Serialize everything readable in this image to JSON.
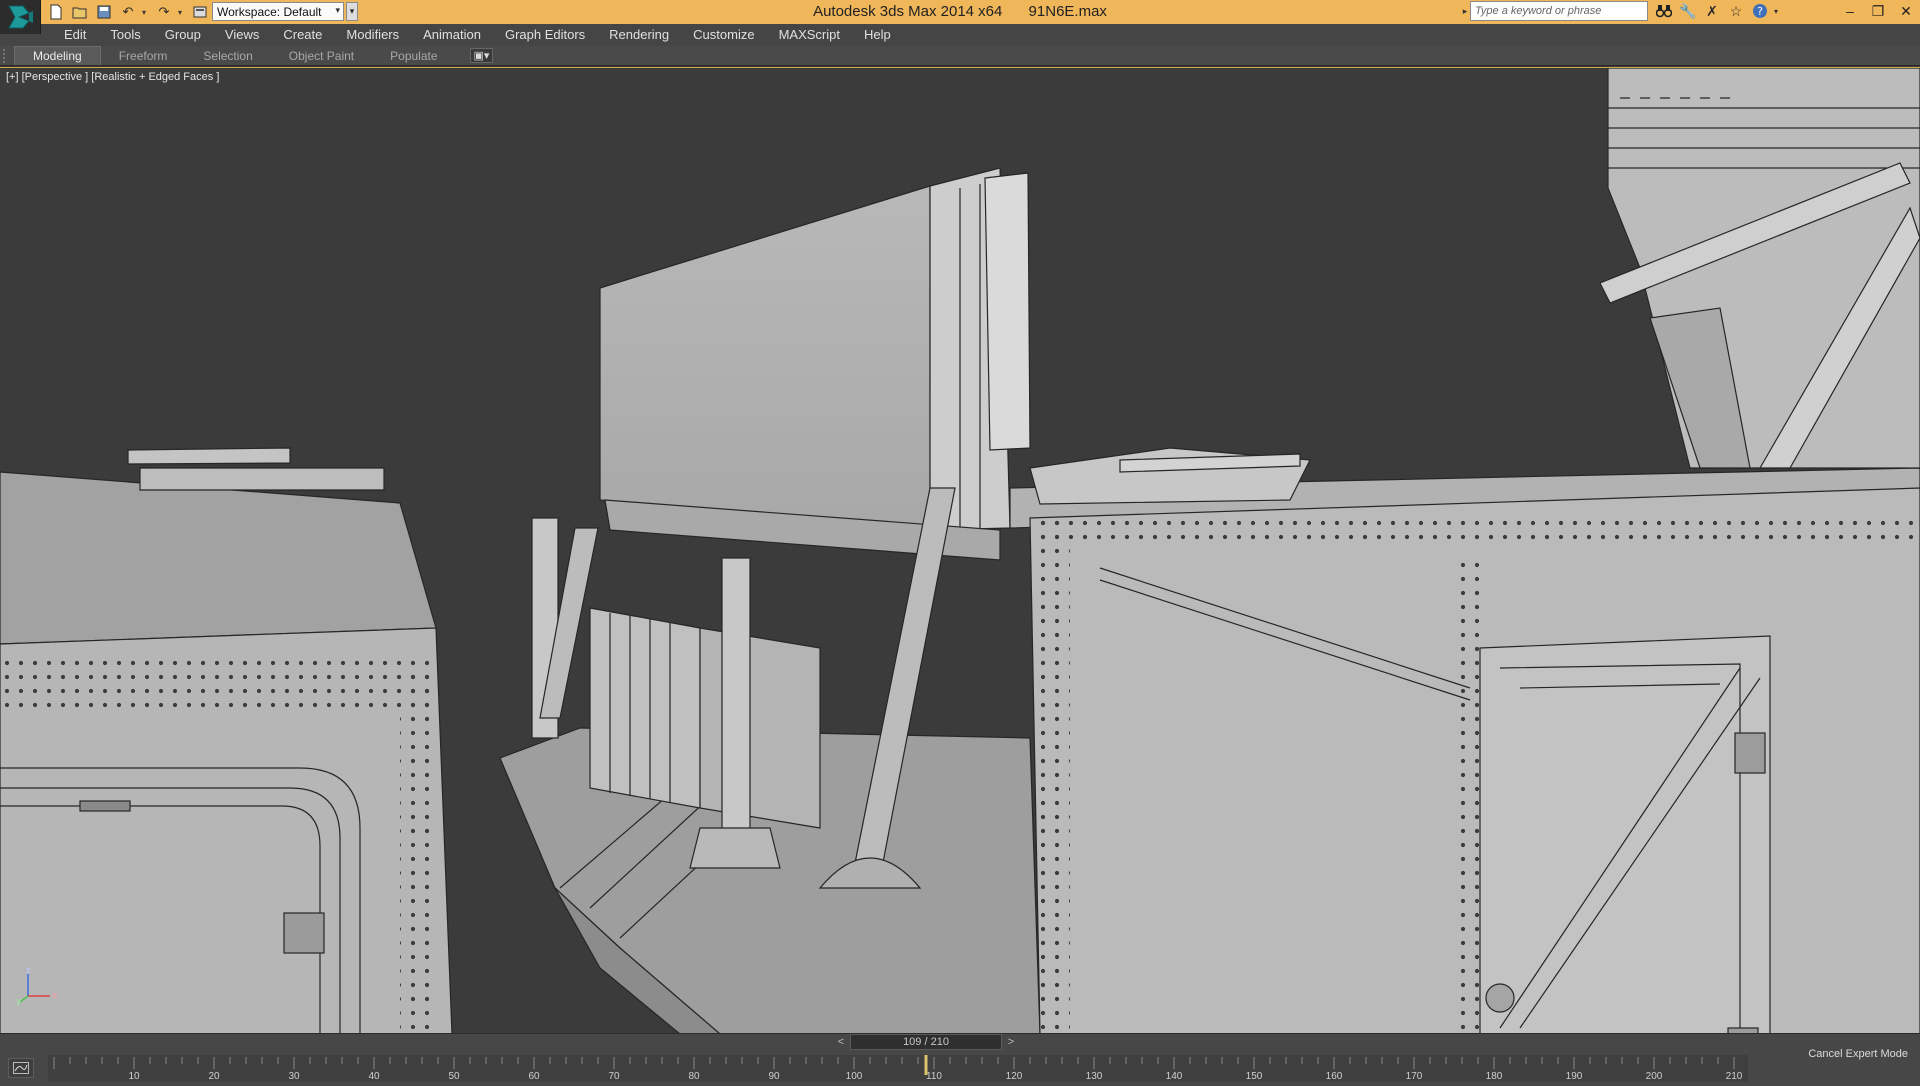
{
  "title_bar": {
    "app_name": "Autodesk 3ds Max  2014 x64",
    "file_name": "91N6E.max",
    "workspace": "Workspace: Default",
    "search_placeholder": "Type a keyword or phrase",
    "accent_color": "#f0b65a"
  },
  "quick_access": [
    "new-file-icon",
    "open-file-icon",
    "save-icon",
    "undo-icon",
    "redo-icon",
    "project-folder-icon"
  ],
  "infocenter_icons": [
    "binoculars-icon",
    "key-tools-icon",
    "exchange-icon",
    "star-icon",
    "help-icon"
  ],
  "menu": [
    "Edit",
    "Tools",
    "Group",
    "Views",
    "Create",
    "Modifiers",
    "Animation",
    "Graph Editors",
    "Rendering",
    "Customize",
    "MAXScript",
    "Help"
  ],
  "ribbon": {
    "tabs": [
      "Modeling",
      "Freeform",
      "Selection",
      "Object Paint",
      "Populate"
    ],
    "active_tab": "Modeling"
  },
  "viewport": {
    "label": "[+] [Perspective ] [Realistic + Edged Faces ]",
    "axis_labels": {
      "x": "x",
      "y": "y",
      "z": "z"
    }
  },
  "timeline": {
    "frame_indicator": "109 / 210",
    "prev_symbol": "<",
    "next_symbol": ">",
    "current_frame": 109,
    "total_frames": 210,
    "tick_labels": [
      "10",
      "20",
      "30",
      "40",
      "50",
      "60",
      "70",
      "80",
      "90",
      "100",
      "110",
      "120",
      "130",
      "140",
      "150",
      "160",
      "170",
      "180",
      "190",
      "200",
      "210"
    ],
    "expert_mode_label": "Cancel Expert Mode"
  }
}
